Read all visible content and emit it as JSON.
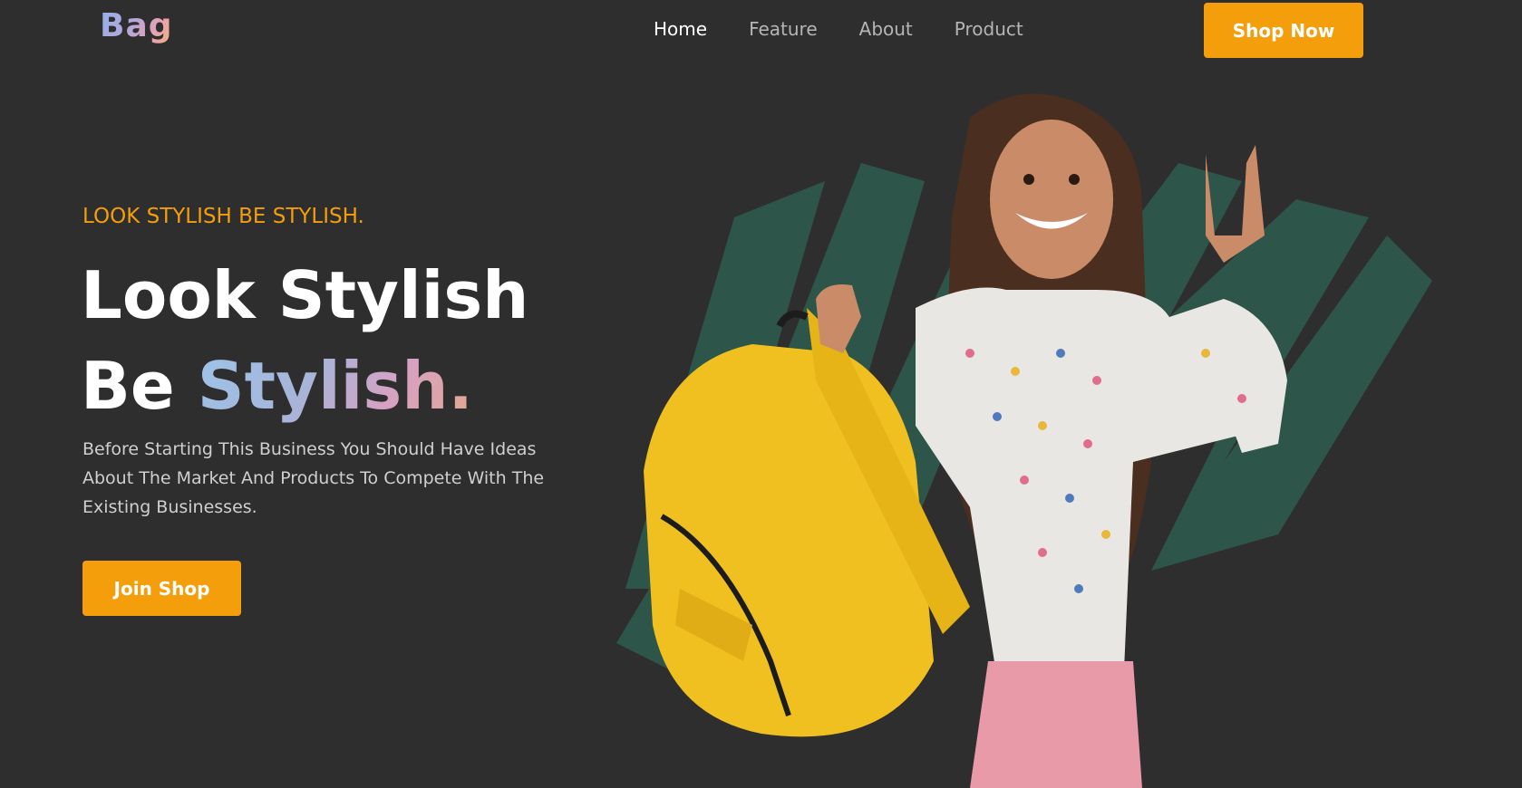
{
  "brand": {
    "logo_text": "Bag"
  },
  "nav": {
    "items": [
      {
        "label": "Home",
        "active": true
      },
      {
        "label": "Feature",
        "active": false
      },
      {
        "label": "About",
        "active": false
      },
      {
        "label": "Product",
        "active": false
      }
    ],
    "cta_label": "Shop Now"
  },
  "hero": {
    "eyebrow": "LOOK STYLISH BE STYLISH.",
    "headline_line1": "Look Stylish",
    "headline_line2_plain": "Be ",
    "headline_line2_gradient": "Stylish.",
    "description": "Before Starting This Business You Should Have Ideas About The Market And Products To Compete With The Existing Businesses.",
    "button_label": "Join Shop",
    "image_subject": "girl-with-yellow-backpack"
  },
  "colors": {
    "background": "#2e2e2e",
    "accent": "#f59e0b",
    "brush": "#2f5a4e",
    "nav_inactive": "#b5b5b5",
    "text_muted": "#cfcfcf"
  }
}
